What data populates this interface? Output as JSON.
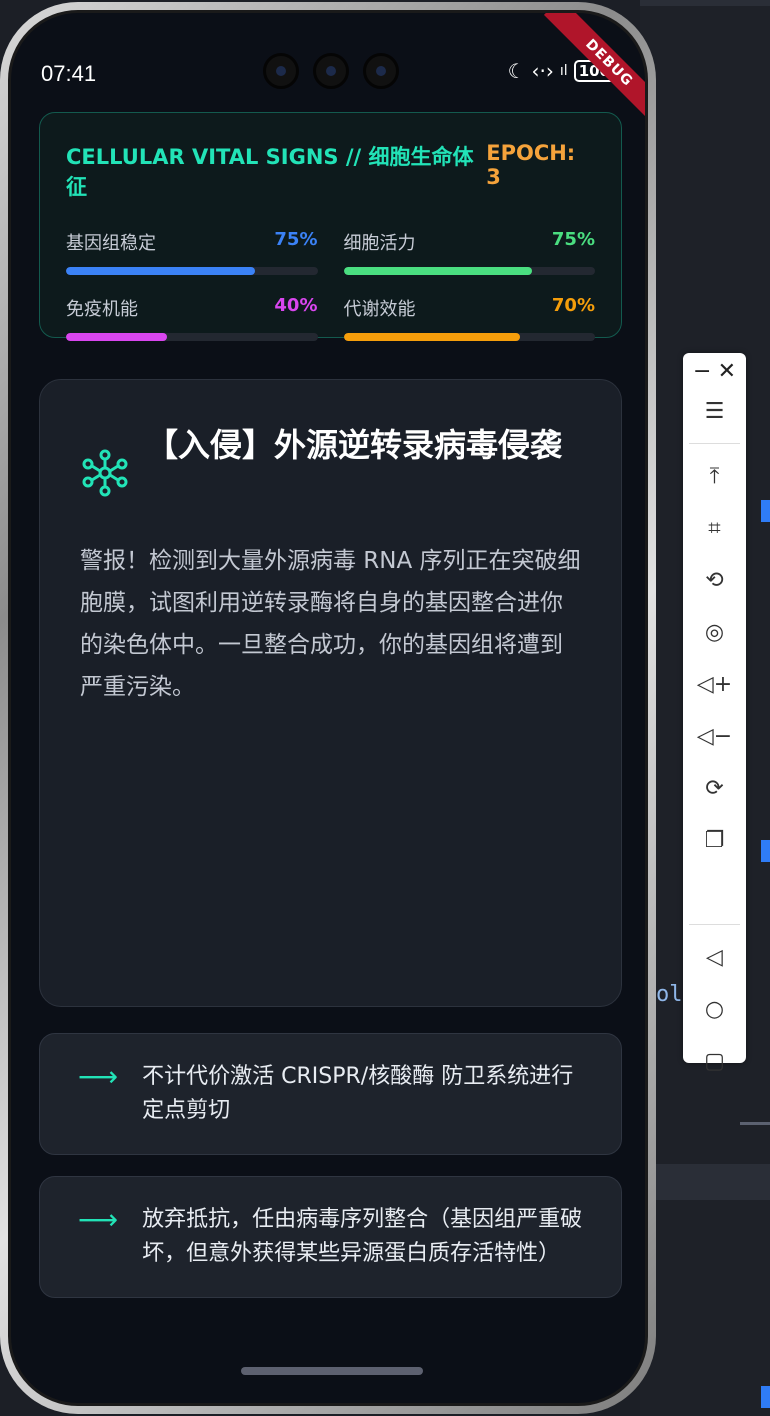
{
  "status_bar": {
    "time": "07:41",
    "icons": [
      "moon-icon",
      "code-icon",
      "signal-icon"
    ],
    "battery": "100",
    "debug_label": "DEBUG"
  },
  "vitals": {
    "title": "CELLULAR VITAL SIGNS // 细胞生命体征",
    "epoch": "EPOCH: 3",
    "stats": [
      {
        "label": "基因组稳定",
        "value": "75%",
        "level": 0.75,
        "color": "#3b82f6"
      },
      {
        "label": "细胞活力",
        "value": "75%",
        "level": 0.75,
        "color": "#4ade80"
      },
      {
        "label": "免疫机能",
        "value": "40%",
        "level": 0.4,
        "color": "#d946ef"
      },
      {
        "label": "代谢效能",
        "value": "70%",
        "level": 0.7,
        "color": "#f59e0b"
      }
    ]
  },
  "event": {
    "icon": "virus-network-icon",
    "title": "【入侵】外源逆转录病毒侵袭",
    "description": "警报！检测到大量外源病毒 RNA 序列正在突破细胞膜，试图利用逆转录酶将自身的基因整合进你的染色体中。一旦整合成功，你的基因组将遭到严重污染。"
  },
  "choices": [
    {
      "arrow": "⟶",
      "text": "不计代价激活 CRISPR/核酸酶 防卫系统进行定点剪切"
    },
    {
      "arrow": "⟶",
      "text": "放弃抵抗，任由病毒序列整合（基因组严重破坏，但意外获得某些异源蛋白质存活特性）"
    }
  ],
  "toolbar": {
    "minimize": "−",
    "close": "✕",
    "buttons": [
      "menu-icon",
      "pin-top-icon",
      "crop-icon",
      "rotate-icon",
      "record-icon",
      "volume-up-icon",
      "volume-down-icon",
      "rotate-device-icon",
      "screen-copy-icon",
      "back-icon",
      "home-icon",
      "recents-icon"
    ]
  },
  "background": {
    "code_fragment": "ol"
  },
  "colors": {
    "accent": "#22e3b7",
    "epoch": "#f5a33b"
  }
}
